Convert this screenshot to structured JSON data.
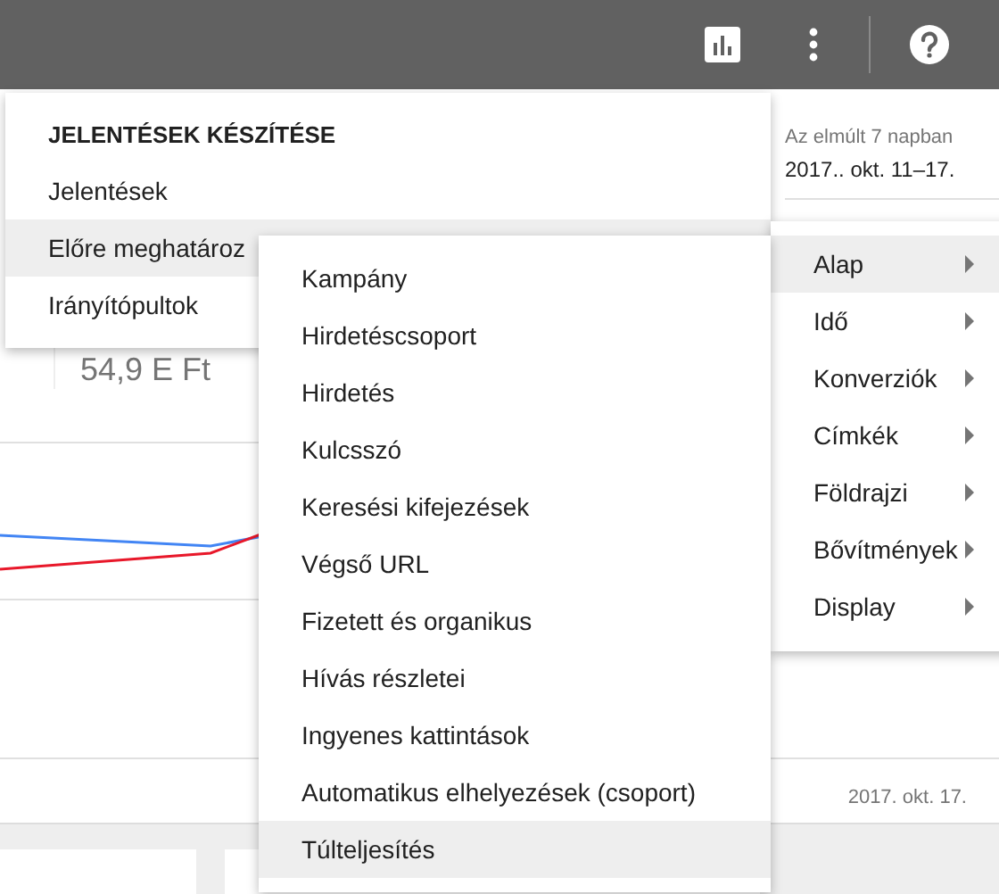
{
  "date_range": {
    "label": "Az elmúlt 7 napban",
    "value": "2017.. okt. 11–17."
  },
  "summary": {
    "value": "54,9 E Ft"
  },
  "chart": {
    "x_label": "2017. okt. 17."
  },
  "reports_menu": {
    "heading": "JELENTÉSEK KÉSZÍTÉSE",
    "items": [
      {
        "label": "Jelentések",
        "selected": false
      },
      {
        "label": "Előre meghatároz",
        "selected": true
      },
      {
        "label": "Irányítópultok",
        "selected": false
      }
    ]
  },
  "category_menu": {
    "items": [
      {
        "label": "Alap",
        "selected": true
      },
      {
        "label": "Idő",
        "selected": false
      },
      {
        "label": "Konverziók",
        "selected": false
      },
      {
        "label": "Címkék",
        "selected": false
      },
      {
        "label": "Földrajzi",
        "selected": false
      },
      {
        "label": "Bővítmények",
        "selected": false
      },
      {
        "label": "Display",
        "selected": false
      }
    ]
  },
  "report_menu": {
    "items": [
      {
        "label": "Kampány",
        "selected": false
      },
      {
        "label": "Hirdetéscsoport",
        "selected": false
      },
      {
        "label": "Hirdetés",
        "selected": false
      },
      {
        "label": "Kulcsszó",
        "selected": false
      },
      {
        "label": "Keresési kifejezések",
        "selected": false
      },
      {
        "label": "Végső URL",
        "selected": false
      },
      {
        "label": "Fizetett és organikus",
        "selected": false
      },
      {
        "label": "Hívás részletei",
        "selected": false
      },
      {
        "label": "Ingyenes kattintások",
        "selected": false
      },
      {
        "label": "Automatikus elhelyezések (csoport)",
        "selected": false
      },
      {
        "label": "Túlteljesítés",
        "selected": true
      }
    ]
  }
}
